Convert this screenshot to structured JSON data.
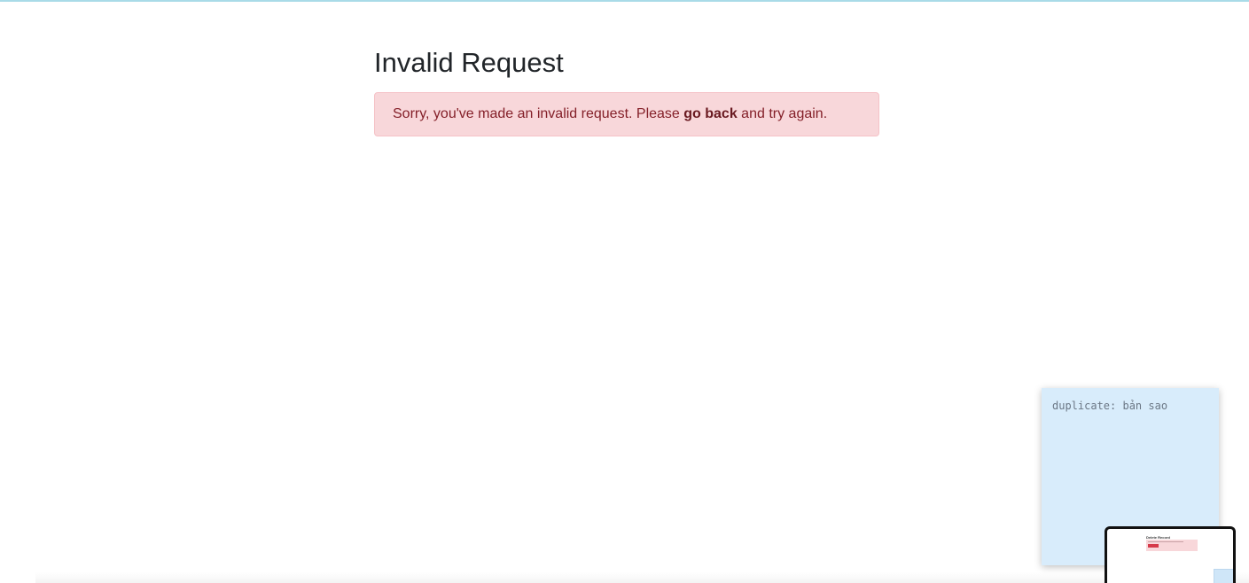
{
  "page": {
    "title": "Invalid Request"
  },
  "alert": {
    "text_before": "Sorry, you've made an invalid request. Please ",
    "link_text": "go back",
    "text_after": " and try again."
  },
  "sticky_note": {
    "text": "duplicate: bản sao"
  },
  "thumbnail": {
    "title": "Delete Record"
  },
  "colors": {
    "alert_background": "#f8d7da",
    "alert_text": "#842029",
    "sticky_note_background": "#d8ecfb"
  }
}
